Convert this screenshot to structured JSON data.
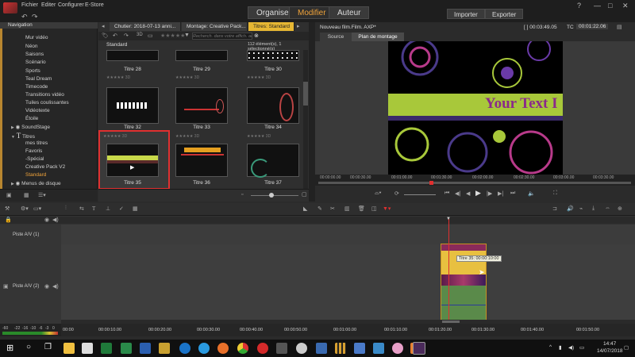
{
  "topbar": {
    "menu": [
      "Fichier",
      "Editer",
      "Configurer",
      "E-Store"
    ],
    "modes": [
      "Organiser",
      "Modifier",
      "Auteur"
    ],
    "active_mode": "Modifier",
    "import_label": "Importer",
    "export_label": "Exporter"
  },
  "sidebar": {
    "header_item": "Navigation",
    "items": [
      "Mur vidéo",
      "Néon",
      "Saisons",
      "Scénario",
      "Sports",
      "Teal Dream",
      "Timecode",
      "Transitions vidéo",
      "Tuiles coulissantes",
      "Vidéotexte",
      "Étoile",
      "SoundStage",
      "Titres",
      "mes titres",
      "Favoris",
      "-Spécial",
      "Creative Pack V2",
      "Standard",
      "Menus de disque"
    ],
    "selected": "Standard"
  },
  "library": {
    "tabs": [
      "Chutier: 2018-07-13 anni...",
      "Montage: Creative Pack...",
      "Titres: Standard"
    ],
    "search_placeholder": "Recherch. dans votre affich. ac",
    "breadcrumb": "Standard",
    "count": "112 élément(s), 1 sélectionné(s)",
    "rating_label": "3D",
    "thumbs": [
      {
        "title": "Titre 28"
      },
      {
        "title": "Titre 29"
      },
      {
        "title": "Titre 30"
      },
      {
        "title": "Titre 32"
      },
      {
        "title": "Titre 33"
      },
      {
        "title": "Titre 34"
      },
      {
        "title": "Titre 35"
      },
      {
        "title": "Titre 36"
      },
      {
        "title": "Titre 37"
      }
    ],
    "selected_title": "Titre 35"
  },
  "player": {
    "project_title": "Nouveau film.Film. AXP*",
    "duration": "[ ] 00:03:49.05",
    "tc_label": "TC",
    "timecode": "00:01:22.06",
    "source_tab": "Source",
    "timeline_tab": "Plan de montage",
    "overlay_text": "Your Text I",
    "ruler": [
      "00:00:00.00",
      "00:00:30.00",
      "00:01:00.00",
      "00:01:30.00",
      "00:02:00.00",
      "00:02:30.00",
      "00:03:00.00",
      "00:03:30.00"
    ]
  },
  "timeline": {
    "track1": "Piste A/V (1)",
    "track2": "Piste A/V (2)",
    "tooltip": "Titre 35: 00:00:10:00",
    "ruler": [
      "00:00",
      "00:00:10.00",
      "00:00:20.00",
      "00:00:30.00",
      "00:00:40.00",
      "00:00:50.00",
      "00:01:00.00",
      "00:01:10.00",
      "00:01:20.00",
      "00:01:30.00",
      "00:01:40.00",
      "00:01:50.00"
    ],
    "meter": [
      "-60",
      "-22",
      "-16",
      "-10",
      "-6",
      "-3",
      "0"
    ]
  },
  "taskbar": {
    "time": "14:47",
    "date": "14/07/2018"
  },
  "colors": {
    "accent": "#f0a33a",
    "selection": "#e03030",
    "clip": "#e8c040"
  }
}
